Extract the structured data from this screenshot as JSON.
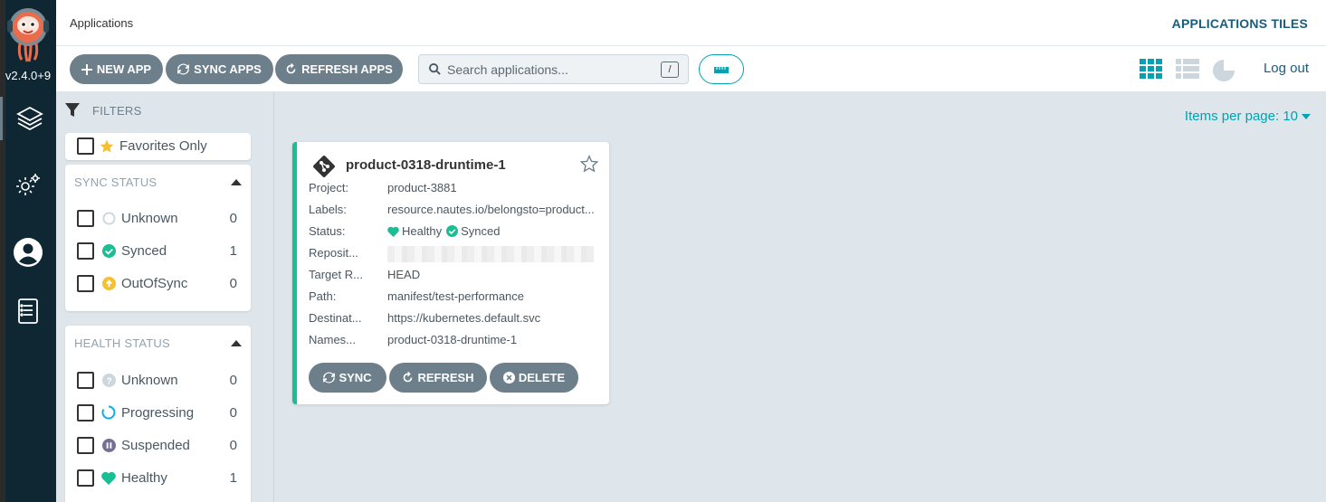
{
  "nav": {
    "version": "v2.4.0+9",
    "items": [
      {
        "name": "applications",
        "icon": "layers-icon",
        "active": true
      },
      {
        "name": "settings",
        "icon": "gears-icon",
        "active": false
      },
      {
        "name": "user-info",
        "icon": "user-circle-icon",
        "active": false
      },
      {
        "name": "documentation",
        "icon": "book-icon",
        "active": false
      }
    ]
  },
  "topbar": {
    "title": "Applications",
    "view_title": "APPLICATIONS TILES"
  },
  "toolbar": {
    "new_app": "NEW APP",
    "sync_apps": "SYNC APPS",
    "refresh_apps": "REFRESH APPS",
    "search_placeholder": "Search applications...",
    "search_shortcut": "/",
    "logout": "Log out"
  },
  "filters": {
    "title": "FILTERS",
    "favorites": "Favorites Only",
    "sync_status": {
      "title": "SYNC STATUS",
      "items": [
        {
          "label": "Unknown",
          "count": "0",
          "icon": "circle-outline-icon",
          "color": "#ccd6dd"
        },
        {
          "label": "Synced",
          "count": "1",
          "icon": "check-circle-icon",
          "color": "#18be94"
        },
        {
          "label": "OutOfSync",
          "count": "0",
          "icon": "arrow-up-circle-icon",
          "color": "#f4c030"
        }
      ]
    },
    "health_status": {
      "title": "HEALTH STATUS",
      "items": [
        {
          "label": "Unknown",
          "count": "0",
          "icon": "question-circle-icon",
          "color": "#ccd6dd"
        },
        {
          "label": "Progressing",
          "count": "0",
          "icon": "progress-circle-icon",
          "color": "#0dadea"
        },
        {
          "label": "Suspended",
          "count": "0",
          "icon": "pause-circle-icon",
          "color": "#766f94"
        },
        {
          "label": "Healthy",
          "count": "1",
          "icon": "heart-icon",
          "color": "#18be94"
        }
      ]
    }
  },
  "main": {
    "items_per_page": "Items per page: 10",
    "app": {
      "name": "product-0318-druntime-1",
      "fields": [
        {
          "key": "Project:",
          "value": "product-3881"
        },
        {
          "key": "Labels:",
          "value": "resource.nautes.io/belongsto=product..."
        },
        {
          "key": "Status:",
          "health": "Healthy",
          "sync": "Synced"
        },
        {
          "key": "Reposit...",
          "value": "",
          "redacted": true
        },
        {
          "key": "Target R...",
          "value": "HEAD"
        },
        {
          "key": "Path:",
          "value": "manifest/test-performance"
        },
        {
          "key": "Destinat...",
          "value": "https://kubernetes.default.svc"
        },
        {
          "key": "Names...",
          "value": "product-0318-druntime-1"
        }
      ],
      "actions": {
        "sync": "SYNC",
        "refresh": "REFRESH",
        "delete": "DELETE"
      }
    }
  },
  "colors": {
    "accent": "#00a2b3",
    "healthy": "#18be94",
    "button": "#6d7f8b",
    "nav_bg": "#0f2733"
  }
}
